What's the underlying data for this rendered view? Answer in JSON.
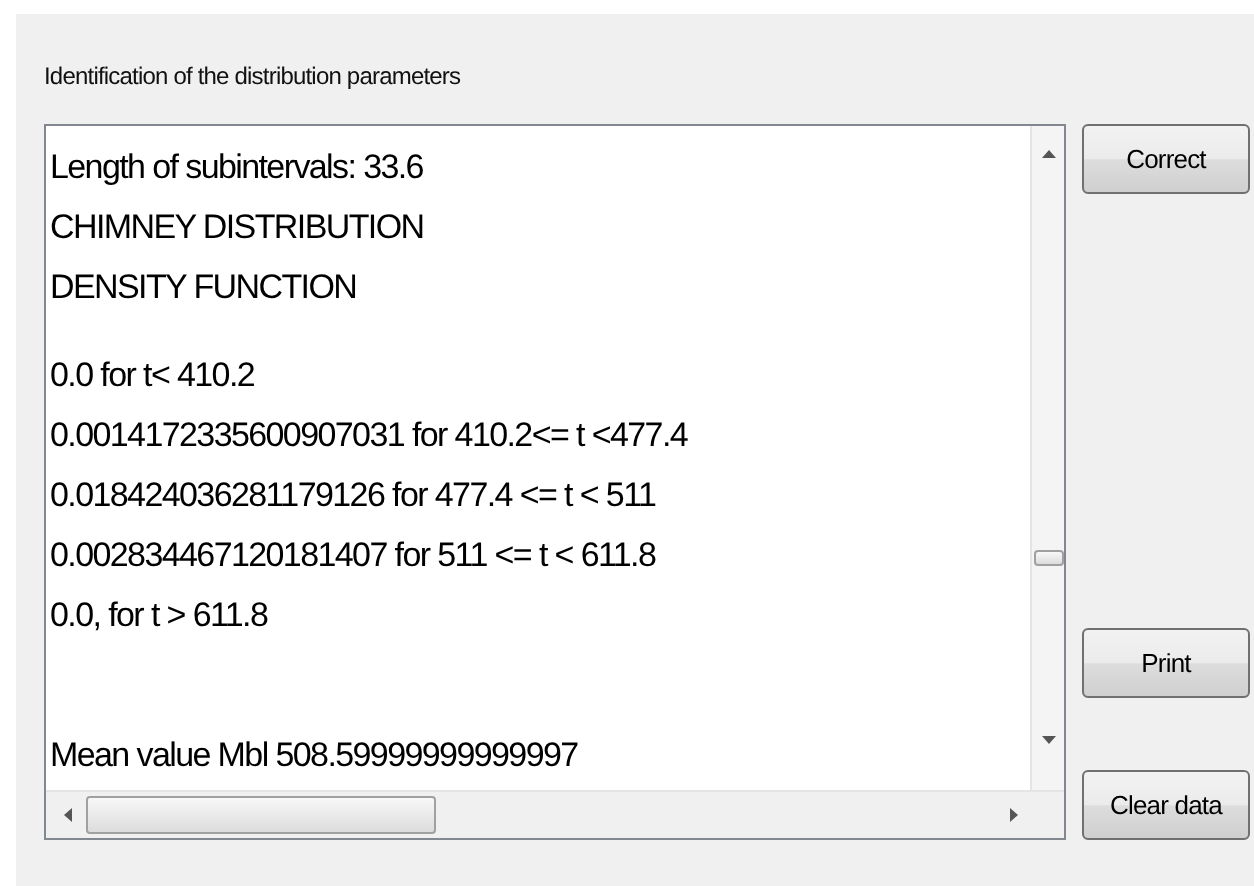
{
  "group_title": "Identification of the distribution parameters",
  "output_blocks": [
    [
      "Length of subintervals: 33.6",
      "CHIMNEY DISTRIBUTION",
      "DENSITY FUNCTION"
    ],
    [
      "0.0 for t< 410.2",
      "0.0014172335600907031 for 410.2<= t <477.4",
      "0.018424036281179126 for 477.4 <= t < 511",
      "0.002834467120181407 for 511 <= t < 611.8",
      "0.0, for t > 611.8"
    ],
    [
      "Mean value Mbl 508.59999999999997"
    ]
  ],
  "buttons": [
    {
      "label": "Correct"
    },
    {
      "label": "Print"
    },
    {
      "label": "Clear data"
    }
  ]
}
